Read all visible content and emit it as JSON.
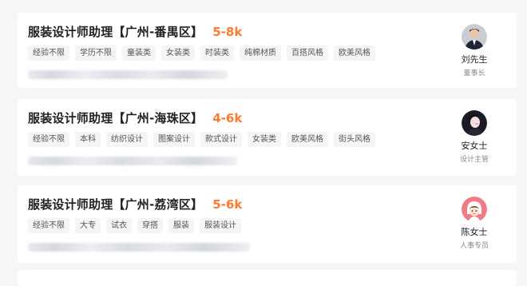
{
  "jobs": [
    {
      "title": "服装设计师助理【广州-番禺区】",
      "salary": "5-8k",
      "tags": [
        "经验不限",
        "学历不限",
        "童装类",
        "女装类",
        "时装类",
        "纯棉材质",
        "百搭风格",
        "欧美风格"
      ],
      "recruiter": {
        "name": "刘先生",
        "role": "董事长",
        "avatar_icon": "male-avatar-icon"
      }
    },
    {
      "title": "服装设计师助理【广州-海珠区】",
      "salary": "4-6k",
      "tags": [
        "经验不限",
        "本科",
        "纺织设计",
        "图案设计",
        "款式设计",
        "女装类",
        "欧美风格",
        "街头风格"
      ],
      "recruiter": {
        "name": "安女士",
        "role": "设计主管",
        "avatar_icon": "female-avatar-icon"
      }
    },
    {
      "title": "服装设计师助理【广州-荔湾区】",
      "salary": "5-6k",
      "tags": [
        "经验不限",
        "大专",
        "试衣",
        "穿搭",
        "服装",
        "服装设计"
      ],
      "recruiter": {
        "name": "陈女士",
        "role": "人事专员",
        "avatar_icon": "cartoon-avatar-icon"
      }
    }
  ],
  "colors": {
    "salary": "#ff7a2e",
    "background": "#f5f6f8"
  }
}
